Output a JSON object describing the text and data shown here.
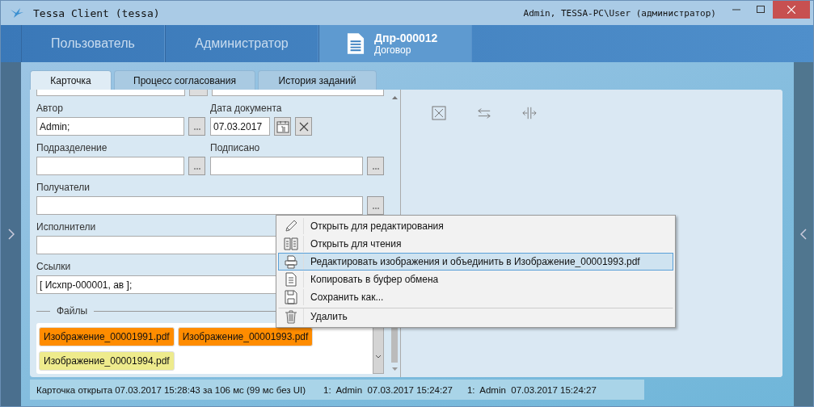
{
  "window": {
    "title": "Tessa Client (tessa)",
    "user": "Admin, TESSA-PC\\User (администратор)"
  },
  "nav": [
    {
      "kind": "text",
      "label": "Пользователь",
      "selected": false
    },
    {
      "kind": "text",
      "label": "Администратор",
      "selected": false
    },
    {
      "kind": "document",
      "title": "Дпр-000012",
      "subtitle": "Договор",
      "selected": true
    }
  ],
  "tabs": [
    {
      "label": "Карточка",
      "selected": true
    },
    {
      "label": "Процесс согласования",
      "selected": false
    },
    {
      "label": "История заданий",
      "selected": false
    }
  ],
  "form_rows": [
    [
      {
        "kind": "lookup",
        "label": "Автор",
        "value": "Admin;"
      },
      {
        "kind": "date",
        "label": "Дата документа",
        "value": "07.03.2017"
      }
    ],
    [
      {
        "kind": "lookup",
        "label": "Подразделение"
      },
      {
        "kind": "lookup",
        "label": "Подписано"
      }
    ],
    [
      {
        "kind": "lookup",
        "label": "Получатели"
      }
    ],
    [
      {
        "kind": "plain",
        "label": "Исполнители"
      }
    ],
    [
      {
        "kind": "plain",
        "label": "Ссылки",
        "value": "[ Исхпр-000001, ав ];"
      }
    ]
  ],
  "files": {
    "title": "Файлы",
    "items": [
      {
        "name": "Изображение_00001991.pdf",
        "color": "#ff8c00"
      },
      {
        "name": "Изображение_00001993.pdf",
        "color": "#ff8c00"
      },
      {
        "name": "Изображение_00001994.pdf",
        "color": "#eeeb8c"
      }
    ]
  },
  "context_menu": [
    {
      "label": "Открыть для редактирования",
      "selected": false,
      "separated": false
    },
    {
      "label": "Открыть для чтения",
      "selected": false,
      "separated": false
    },
    {
      "label": "Редактировать изображения и объединить в Изображение_00001993.pdf",
      "selected": true,
      "separated": false
    },
    {
      "label": "Копировать в буфер обмена",
      "selected": false,
      "separated": false
    },
    {
      "label": "Сохранить как...",
      "selected": false,
      "separated": false
    },
    {
      "label": "Удалить",
      "selected": false,
      "separated": true
    }
  ],
  "status_bar": [
    "Карточка открыта 07.03.2017 15:28:43 за 106 мс (99 мс без UI)",
    "1:  Admin  07.03.2017 15:24:27",
    "1:  Admin  07.03.2017 15:24:27"
  ]
}
